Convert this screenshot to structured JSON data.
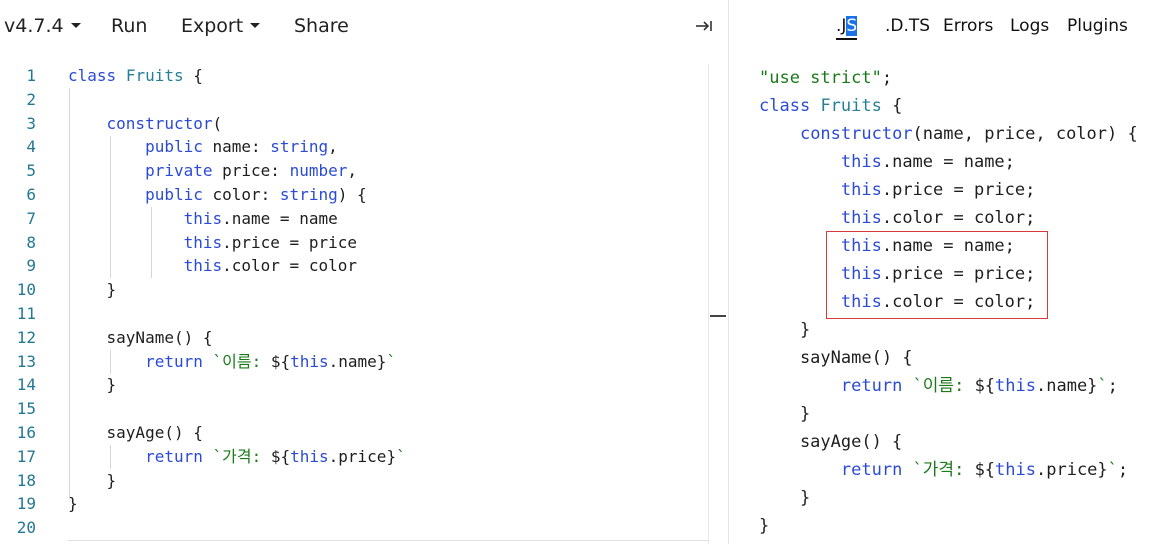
{
  "toolbar": {
    "version": "v4.7.4",
    "run": "Run",
    "export": "Export",
    "share": "Share",
    "collapse_icon": "arrow-to-right-icon"
  },
  "output_tabs": {
    "js_pre": ".J",
    "js_sel": "S",
    "dts": ".D.TS",
    "errors": "Errors",
    "logs": "Logs",
    "plugins": "Plugins"
  },
  "editor": {
    "line_numbers": [
      "1",
      "2",
      "3",
      "4",
      "5",
      "6",
      "7",
      "8",
      "9",
      "10",
      "11",
      "12",
      "13",
      "14",
      "15",
      "16",
      "17",
      "18",
      "19",
      "20"
    ],
    "lines": [
      [
        {
          "t": "class",
          "c": "k"
        },
        {
          "t": " "
        },
        {
          "t": "Fruits",
          "c": "c"
        },
        {
          "t": " {"
        }
      ],
      [],
      [
        {
          "t": "    "
        },
        {
          "t": "constructor",
          "c": "k"
        },
        {
          "t": "("
        }
      ],
      [
        {
          "t": "        "
        },
        {
          "t": "public",
          "c": "k"
        },
        {
          "t": " name: "
        },
        {
          "t": "string",
          "c": "k"
        },
        {
          "t": ","
        }
      ],
      [
        {
          "t": "        "
        },
        {
          "t": "private",
          "c": "k"
        },
        {
          "t": " price: "
        },
        {
          "t": "number",
          "c": "k"
        },
        {
          "t": ","
        }
      ],
      [
        {
          "t": "        "
        },
        {
          "t": "public",
          "c": "k"
        },
        {
          "t": " color: "
        },
        {
          "t": "string",
          "c": "k"
        },
        {
          "t": ") {"
        }
      ],
      [
        {
          "t": "            "
        },
        {
          "t": "this",
          "c": "k"
        },
        {
          "t": ".name = name"
        }
      ],
      [
        {
          "t": "            "
        },
        {
          "t": "this",
          "c": "k"
        },
        {
          "t": ".price = price"
        }
      ],
      [
        {
          "t": "            "
        },
        {
          "t": "this",
          "c": "k"
        },
        {
          "t": ".color = color"
        }
      ],
      [
        {
          "t": "    }"
        }
      ],
      [],
      [
        {
          "t": "    sayName() {"
        }
      ],
      [
        {
          "t": "        "
        },
        {
          "t": "return",
          "c": "k"
        },
        {
          "t": " "
        },
        {
          "t": "`이름: ",
          "c": "s"
        },
        {
          "t": "${"
        },
        {
          "t": "this",
          "c": "k"
        },
        {
          "t": ".name}"
        },
        {
          "t": "`",
          "c": "s"
        }
      ],
      [
        {
          "t": "    }"
        }
      ],
      [],
      [
        {
          "t": "    sayAge() {"
        }
      ],
      [
        {
          "t": "        "
        },
        {
          "t": "return",
          "c": "k"
        },
        {
          "t": " "
        },
        {
          "t": "`가격: ",
          "c": "s"
        },
        {
          "t": "${"
        },
        {
          "t": "this",
          "c": "k"
        },
        {
          "t": ".price}"
        },
        {
          "t": "`",
          "c": "s"
        }
      ],
      [
        {
          "t": "    }"
        }
      ],
      [
        {
          "t": "}"
        }
      ],
      []
    ]
  },
  "output": {
    "lines": [
      [
        {
          "t": "\"use strict\"",
          "c": "s"
        },
        {
          "t": ";"
        }
      ],
      [
        {
          "t": "class",
          "c": "k"
        },
        {
          "t": " "
        },
        {
          "t": "Fruits",
          "c": "c"
        },
        {
          "t": " {"
        }
      ],
      [
        {
          "t": "    "
        },
        {
          "t": "constructor",
          "c": "k"
        },
        {
          "t": "(name, price, color) {"
        }
      ],
      [
        {
          "t": "        "
        },
        {
          "t": "this",
          "c": "k"
        },
        {
          "t": ".name = name;"
        }
      ],
      [
        {
          "t": "        "
        },
        {
          "t": "this",
          "c": "k"
        },
        {
          "t": ".price = price;"
        }
      ],
      [
        {
          "t": "        "
        },
        {
          "t": "this",
          "c": "k"
        },
        {
          "t": ".color = color;"
        }
      ],
      [
        {
          "t": "        "
        },
        {
          "t": "this",
          "c": "k"
        },
        {
          "t": ".name = name;"
        }
      ],
      [
        {
          "t": "        "
        },
        {
          "t": "this",
          "c": "k"
        },
        {
          "t": ".price = price;"
        }
      ],
      [
        {
          "t": "        "
        },
        {
          "t": "this",
          "c": "k"
        },
        {
          "t": ".color = color;"
        }
      ],
      [
        {
          "t": "    }"
        }
      ],
      [
        {
          "t": "    sayName() {"
        }
      ],
      [
        {
          "t": "        "
        },
        {
          "t": "return",
          "c": "k"
        },
        {
          "t": " "
        },
        {
          "t": "`이름: ",
          "c": "s"
        },
        {
          "t": "${"
        },
        {
          "t": "this",
          "c": "k"
        },
        {
          "t": ".name}"
        },
        {
          "t": "`",
          "c": "s"
        },
        {
          "t": ";"
        }
      ],
      [
        {
          "t": "    }"
        }
      ],
      [
        {
          "t": "    sayAge() {"
        }
      ],
      [
        {
          "t": "        "
        },
        {
          "t": "return",
          "c": "k"
        },
        {
          "t": " "
        },
        {
          "t": "`가격: ",
          "c": "s"
        },
        {
          "t": "${"
        },
        {
          "t": "this",
          "c": "k"
        },
        {
          "t": ".price}"
        },
        {
          "t": "`",
          "c": "s"
        },
        {
          "t": ";"
        }
      ],
      [
        {
          "t": "    }"
        }
      ],
      [
        {
          "t": "}"
        }
      ]
    ]
  },
  "colors": {
    "keyword": "#2b4bd6",
    "class_name": "#267f99",
    "string": "#1a7a1a",
    "line_number": "#237893",
    "highlight_box": "#d43a3a",
    "selection": "#1a73e8"
  }
}
